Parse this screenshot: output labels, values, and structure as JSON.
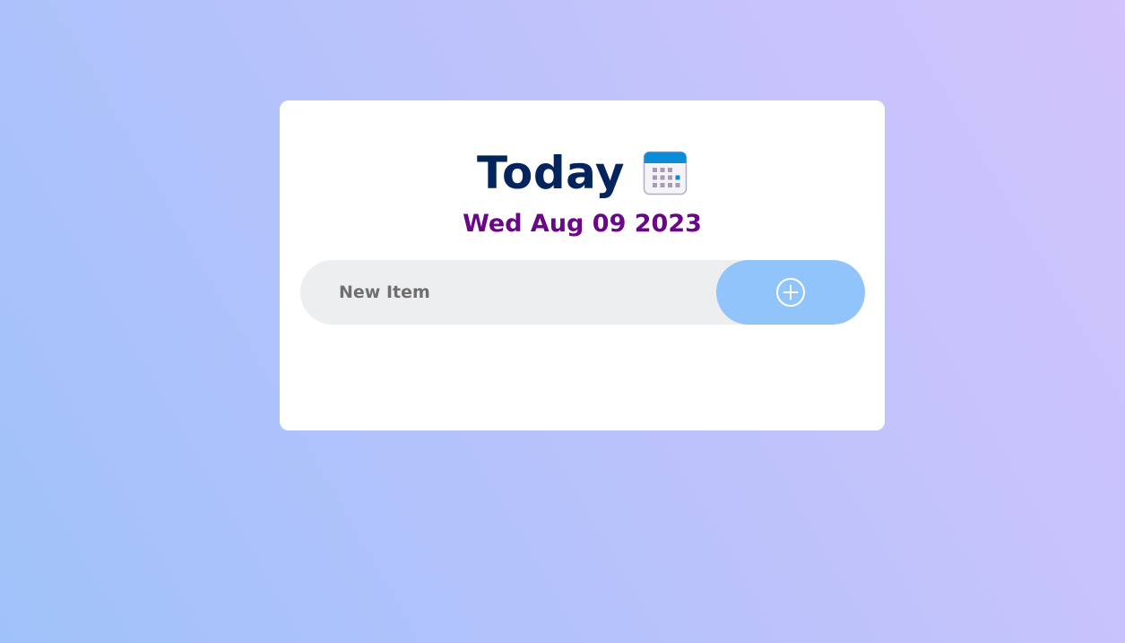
{
  "header": {
    "title": "Today",
    "date": "Wed Aug 09 2023"
  },
  "new_item": {
    "placeholder": "New Item",
    "value": ""
  },
  "add_button": {
    "icon": "plus-circle-icon",
    "label": "Add item"
  },
  "icons": {
    "title_icon": "calendar-icon"
  },
  "colors": {
    "title": "#04245e",
    "date": "#6b0688",
    "input_background": "#edeef0",
    "button_background": "#90c4fa",
    "card_background": "#ffffff"
  },
  "items": []
}
